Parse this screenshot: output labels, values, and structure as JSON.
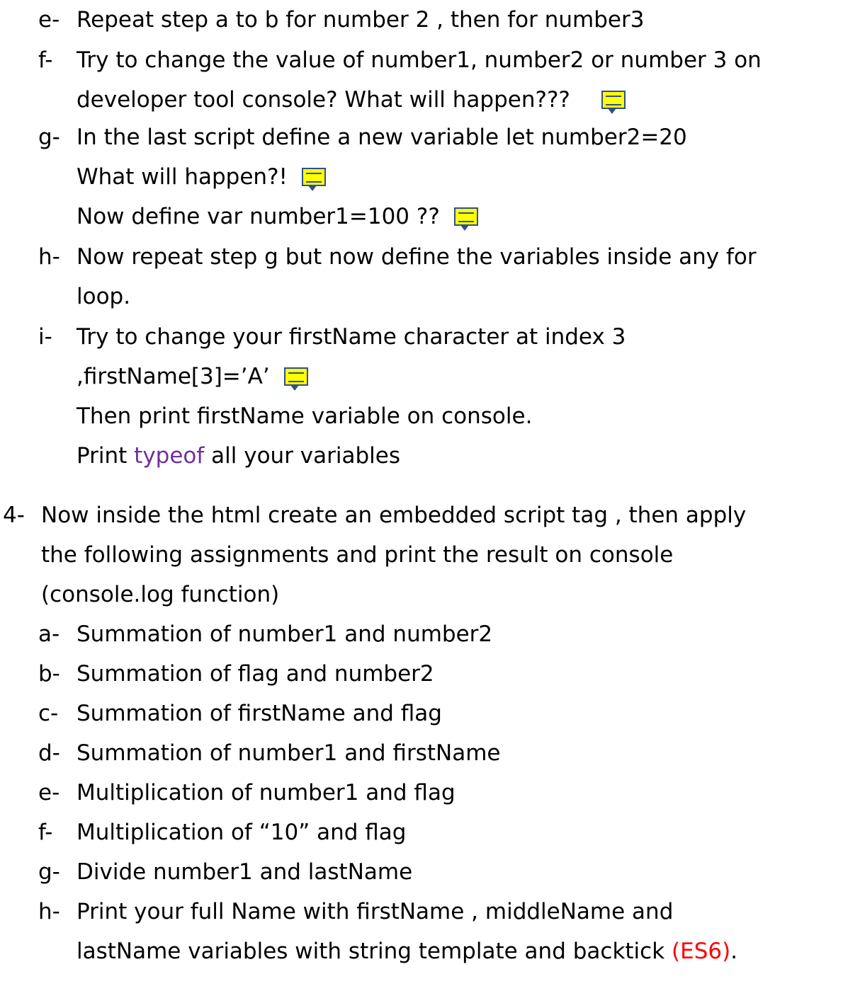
{
  "items": [
    {
      "marker": "e-",
      "lines": [
        "Repeat step a to b  for number 2 , then for number3"
      ]
    },
    {
      "marker": "f-",
      "lines": [
        "Try to change the value of number1, number2 or number 3 on",
        "developer tool console? What will happen???"
      ]
    },
    {
      "marker": "g-",
      "lines": [
        "In the last script define a new variable   let number2=20",
        "What will happen?!",
        "Now define var number1=100 ??"
      ]
    },
    {
      "marker": "h-",
      "lines": [
        "Now repeat step g but now define the variables inside any for",
        "loop."
      ]
    },
    {
      "marker": "i-",
      "lines": [
        "Try to change your firstName character at index 3",
        ",firstName[3]=’A’",
        "Then print firstName variable on console."
      ],
      "print_prefix": "Print ",
      "typeof_word": "typeof",
      "print_suffix": " all your variables"
    }
  ],
  "section4": {
    "marker": "4-",
    "lines": [
      "Now inside the html create an embedded script tag , then apply",
      "the following assignments and print the result on console",
      "(console.log function)"
    ],
    "sub": [
      {
        "marker": "a-",
        "text": "Summation of number1 and number2"
      },
      {
        "marker": "b-",
        "text": "Summation of flag and number2"
      },
      {
        "marker": "c-",
        "text": "Summation of firstName and flag"
      },
      {
        "marker": "d-",
        "text": "Summation of number1 and firstName"
      },
      {
        "marker": "e-",
        "text": "Multiplication of number1 and flag"
      },
      {
        "marker": "f-",
        "text": "Multiplication of “10” and flag"
      },
      {
        "marker": "g-",
        "text": "Divide number1 and lastName"
      },
      {
        "marker": "h-",
        "lines": [
          "Print your full Name  with firstName , middleName and",
          "lastName variables with string template and backtick "
        ],
        "es6": "(ES6)",
        "end": "."
      }
    ]
  },
  "colors": {
    "keyword": "#7030a0",
    "highlight": "#ff0000",
    "note_fill": "#ffff00",
    "note_border": "#2f4f8f"
  },
  "icons": {
    "comment": "comment-note-icon"
  }
}
